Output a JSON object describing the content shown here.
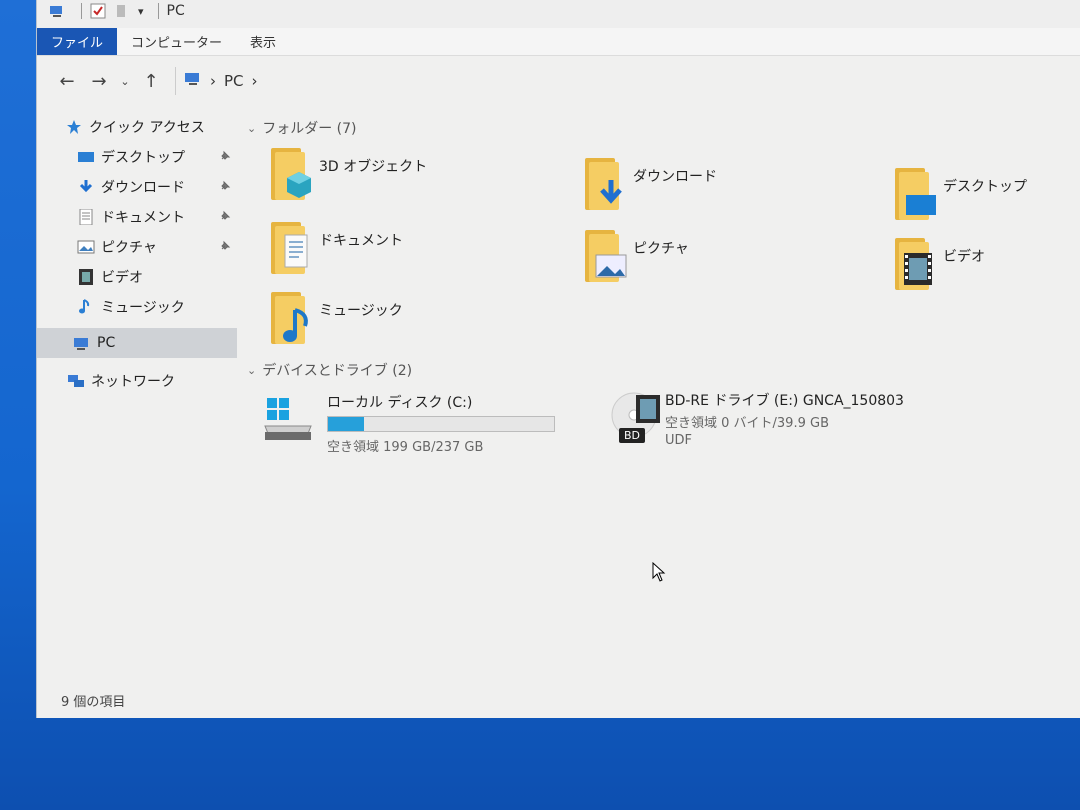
{
  "titlebar": {
    "title": "PC",
    "dropdown_glyph": "▾"
  },
  "ribbon": {
    "tabs": [
      "ファイル",
      "コンピューター",
      "表示"
    ],
    "active_tab": "ファイル"
  },
  "address": {
    "back": "←",
    "forward": "→",
    "recent": "⌄",
    "up": "↑",
    "sep": "›",
    "location": "PC"
  },
  "navpane": {
    "quick_access": "クイック アクセス",
    "items": [
      {
        "label": "デスクトップ",
        "icon": "desktop-icon",
        "pinned": true
      },
      {
        "label": "ダウンロード",
        "icon": "download-icon",
        "pinned": true
      },
      {
        "label": "ドキュメント",
        "icon": "document-icon",
        "pinned": true
      },
      {
        "label": "ピクチャ",
        "icon": "pictures-icon",
        "pinned": true
      },
      {
        "label": "ビデオ",
        "icon": "video-icon",
        "pinned": false
      },
      {
        "label": "ミュージック",
        "icon": "music-icon",
        "pinned": false
      }
    ],
    "pc": "PC",
    "network": "ネットワーク",
    "pin_glyph": "📌"
  },
  "folders": {
    "header": "フォルダー (7)",
    "items": [
      "3D オブジェクト",
      "ダウンロード",
      "デスクトップ",
      "ドキュメント",
      "ピクチャ",
      "ビデオ",
      "ミュージック"
    ]
  },
  "devices": {
    "header": "デバイスとドライブ (2)",
    "local": {
      "name": "ローカル ディスク (C:)",
      "free": "空き領域 199 GB/237 GB",
      "used_fraction": 0.16
    },
    "bd": {
      "name": "BD-RE ドライブ (E:) GNCA_150803",
      "free": "空き領域 0 バイト/39.9 GB",
      "fs": "UDF",
      "disc_label": "BD"
    }
  },
  "status": {
    "count": "9 個の項目"
  },
  "colors": {
    "accent": "#1a56b4",
    "folder": "#f5cd63",
    "drive_fill": "#26a0da"
  }
}
